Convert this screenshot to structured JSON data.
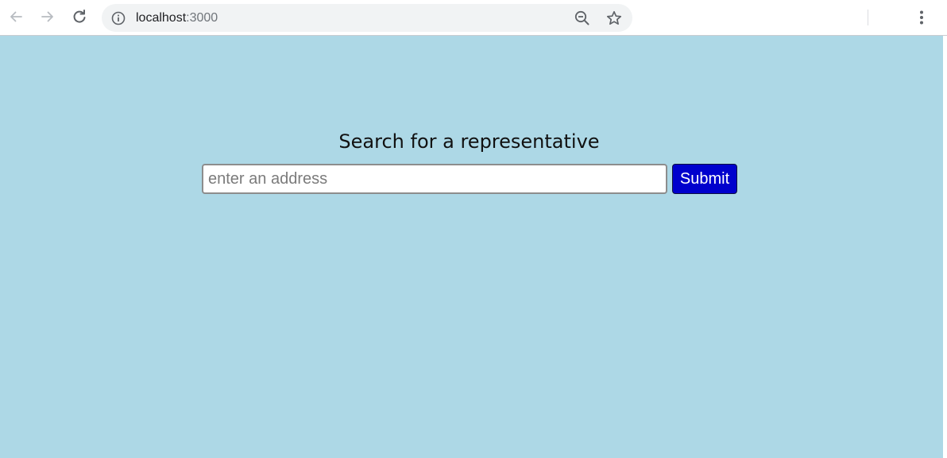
{
  "browser": {
    "url_host": "localhost",
    "url_port": ":3000"
  },
  "page": {
    "heading": "Search for a representative",
    "search": {
      "value": "",
      "placeholder": "enter an address"
    },
    "submit_label": "Submit"
  },
  "colors": {
    "page_background": "#add8e6",
    "submit_button": "#0000cd"
  },
  "icons": {
    "back": "back-arrow-icon",
    "forward": "forward-arrow-icon",
    "reload": "reload-icon",
    "site_info": "info-icon",
    "zoom": "zoom-out-icon",
    "bookmark": "star-icon",
    "menu": "kebab-menu-icon"
  }
}
